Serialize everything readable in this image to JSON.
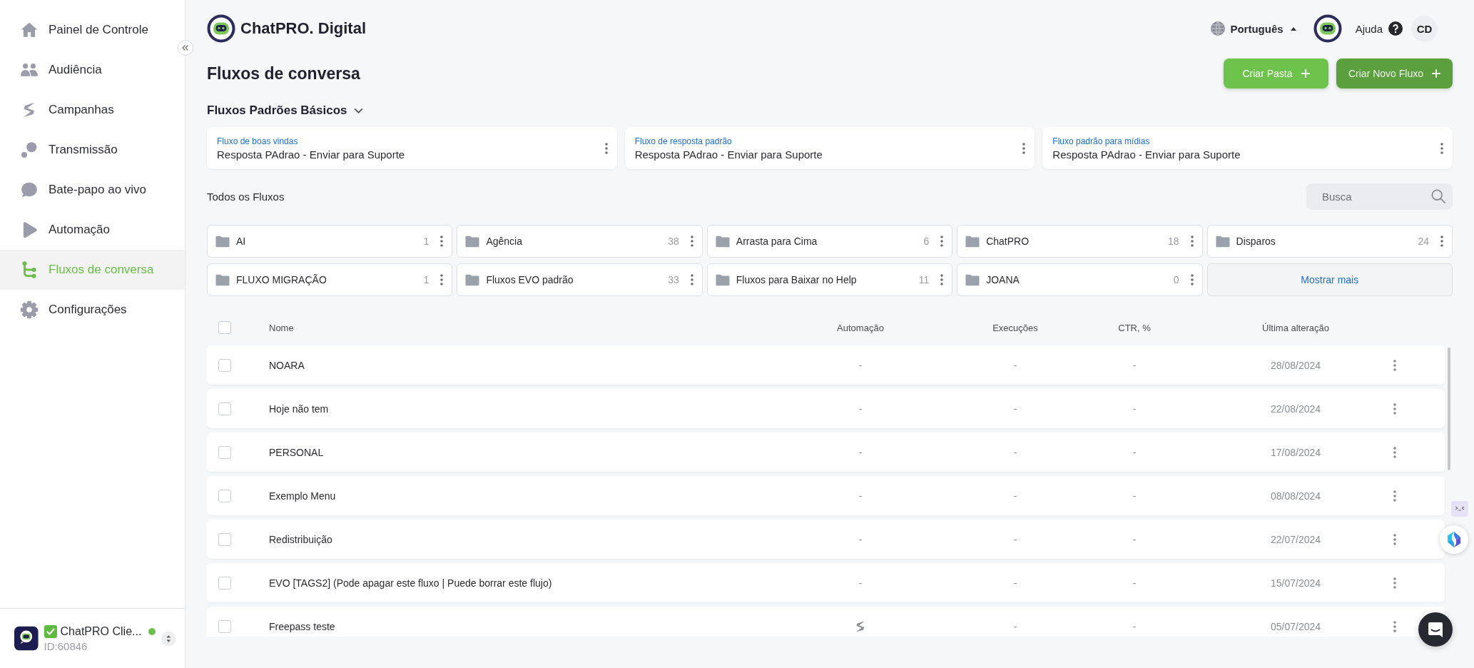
{
  "sidebar": {
    "items": [
      {
        "label": "Painel de Controle",
        "selected": false
      },
      {
        "label": "Audiência",
        "selected": false
      },
      {
        "label": "Campanhas",
        "selected": false
      },
      {
        "label": "Transmissão",
        "selected": false
      },
      {
        "label": "Bate-papo ao vivo",
        "selected": false
      },
      {
        "label": "Automação",
        "selected": false
      },
      {
        "label": "Fluxos de conversa",
        "selected": true
      },
      {
        "label": "Configurações",
        "selected": false
      }
    ],
    "account": {
      "verified": true,
      "name": "ChatPRO Clie...",
      "online": true,
      "id": "ID:60846"
    }
  },
  "header": {
    "brand": "ChatPRO. Digital",
    "language": "Português",
    "help": "Ajuda",
    "user_initials": "CD"
  },
  "page": {
    "title": "Fluxos de conversa",
    "buttons": [
      {
        "label": "Criar Pasta",
        "kind": "secondary"
      },
      {
        "label": "Criar Novo Fluxo",
        "kind": "primary"
      }
    ]
  },
  "default_flows": {
    "title": "Fluxos Padrões Básicos",
    "expanded": true,
    "cards": [
      {
        "label": "Fluxo de boas vindas",
        "value": "Resposta PAdrao - Enviar para Suporte"
      },
      {
        "label": "Fluxo de resposta padrão",
        "value": "Resposta PAdrao - Enviar para Suporte"
      },
      {
        "label": "Fluxo padrão para mídias",
        "value": "Resposta PAdrao - Enviar para Suporte"
      }
    ]
  },
  "all_flows": {
    "title": "Todos os Fluxos",
    "search": {
      "placeholder": "Busca"
    },
    "folders": [
      {
        "name": "AI",
        "count": "1"
      },
      {
        "name": "Agência",
        "count": "38"
      },
      {
        "name": "Arrasta para Cima",
        "count": "6"
      },
      {
        "name": "ChatPRO",
        "count": "18"
      },
      {
        "name": "Disparos",
        "count": "24"
      },
      {
        "name": "FLUXO MIGRAÇÃO",
        "count": "1"
      },
      {
        "name": "Fluxos EVO padrão",
        "count": "33"
      },
      {
        "name": "Fluxos para Baixar no Help",
        "count": "11"
      },
      {
        "name": "JOANA",
        "count": "0"
      }
    ],
    "show_more": "Mostrar mais"
  },
  "table": {
    "select_all": {
      "checked": false
    },
    "columns": [
      "Nome",
      "Automação",
      "Execuções",
      "CTR, %",
      "Última alteração"
    ],
    "rows": [
      {
        "checked": false,
        "name": "NOARA",
        "automation": {
          "kind": "text",
          "text": "-"
        },
        "executions": "-",
        "ctr": "-",
        "modified": "28/08/2024"
      },
      {
        "checked": false,
        "name": "Hoje não tem",
        "automation": {
          "kind": "text",
          "text": "-"
        },
        "executions": "-",
        "ctr": "-",
        "modified": "22/08/2024"
      },
      {
        "checked": false,
        "name": "PERSONAL",
        "automation": {
          "kind": "text",
          "text": "-"
        },
        "executions": "-",
        "ctr": "-",
        "modified": "17/08/2024"
      },
      {
        "checked": false,
        "name": "Exemplo Menu",
        "automation": {
          "kind": "text",
          "text": "-"
        },
        "executions": "-",
        "ctr": "-",
        "modified": "08/08/2024"
      },
      {
        "checked": false,
        "name": "Redistribuição",
        "automation": {
          "kind": "text",
          "text": "-"
        },
        "executions": "-",
        "ctr": "-",
        "modified": "22/07/2024"
      },
      {
        "checked": false,
        "name": "EVO [TAGS2] (Pode apagar este fluxo | Puede borrar este flujo)",
        "automation": {
          "kind": "text",
          "text": "-"
        },
        "executions": "-",
        "ctr": "-",
        "modified": "15/07/2024"
      },
      {
        "checked": false,
        "name": "Freepass teste",
        "automation": {
          "kind": "icon"
        },
        "executions": "-",
        "ctr": "-",
        "modified": "05/07/2024"
      }
    ]
  }
}
